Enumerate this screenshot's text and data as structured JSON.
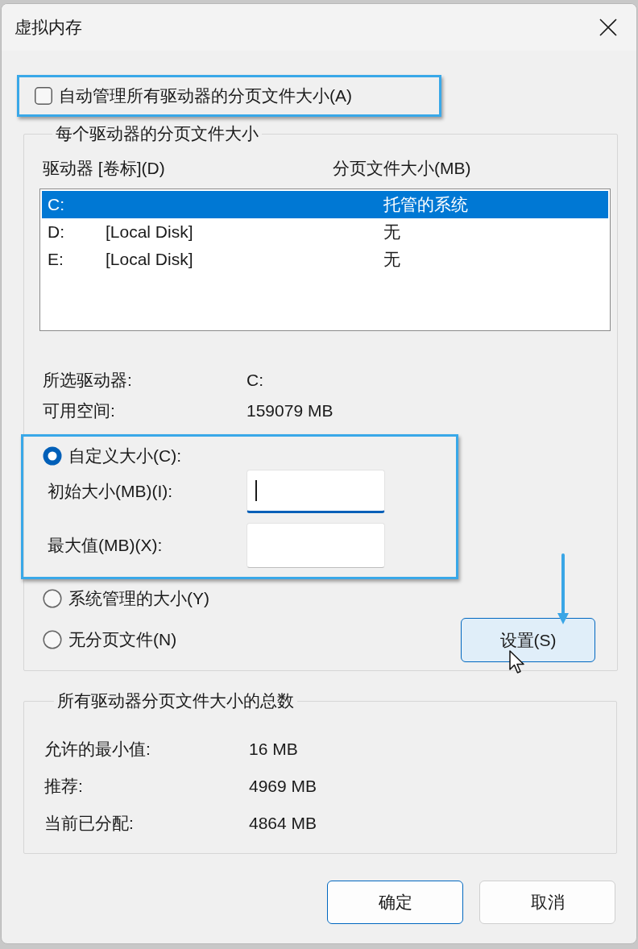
{
  "window": {
    "title": "虚拟内存"
  },
  "auto_manage": {
    "label": "自动管理所有驱动器的分页文件大小(A)",
    "checked": false,
    "highlighted": true
  },
  "per_drive": {
    "title": "每个驱动器的分页文件大小",
    "columns": [
      "驱动器 [卷标](D)",
      "分页文件大小(MB)"
    ],
    "rows": [
      {
        "drive": "C:",
        "size": "托管的系统",
        "selected": true
      },
      {
        "drive": "D:",
        "volume": "[Local Disk]",
        "size": "无",
        "selected": false
      },
      {
        "drive": "E:",
        "volume": "[Local Disk]",
        "size": "无",
        "selected": false
      }
    ],
    "info": [
      {
        "label": "所选驱动器:",
        "value": "C:"
      },
      {
        "label": "可用空间:",
        "value": "159079 MB"
      }
    ],
    "size_options": [
      {
        "kind": "custom",
        "label": "自定义大小(C):",
        "selected": true,
        "highlighted": true,
        "fields": [
          {
            "label": "初始大小(MB)(I):",
            "focused": true
          },
          {
            "label": "最大值(MB)(X):",
            "focused": false
          }
        ]
      },
      {
        "kind": "plain",
        "label": "系统管理的大小(Y)",
        "selected": false
      },
      {
        "kind": "plain",
        "label": "无分页文件(N)",
        "selected": false
      }
    ],
    "set_button": {
      "label": "设置(S)",
      "hovered": true,
      "annotation_arrow": true
    }
  },
  "totals": {
    "title": "所有驱动器分页文件大小的总数",
    "rows": [
      {
        "label": "允许的最小值:",
        "value": "16 MB"
      },
      {
        "label": "推荐:",
        "value": "4969 MB"
      },
      {
        "label": "当前已分配:",
        "value": "4864 MB"
      }
    ]
  },
  "buttons": [
    {
      "label": "确定",
      "default": true
    },
    {
      "label": "取消",
      "default": false
    }
  ]
}
